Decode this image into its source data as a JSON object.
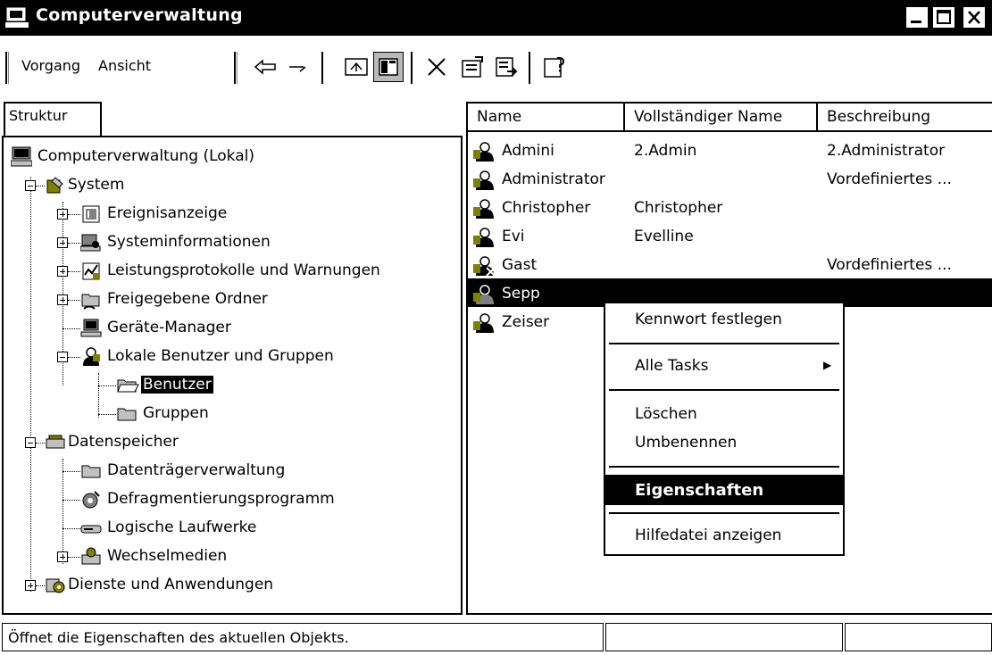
{
  "window": {
    "title": "Computerverwaltung",
    "controls": [
      "minimize",
      "maximize",
      "close"
    ]
  },
  "menu": {
    "items": [
      {
        "label": "Vorgang"
      },
      {
        "label": "Ansicht"
      }
    ]
  },
  "toolbar": {
    "icons": [
      "back-arrow-icon",
      "forward-arrow-icon",
      "up-folder-icon",
      "show-hide-tree-icon",
      "delete-icon",
      "properties-icon",
      "export-list-icon",
      "help-icon"
    ]
  },
  "tree": {
    "tab_label": "Struktur",
    "nodes": [
      {
        "label": "Computerverwaltung (Lokal)",
        "icon": "computer-icon",
        "level": 0
      },
      {
        "label": "System",
        "icon": "system-tools-icon",
        "level": 1,
        "expander": "minus"
      },
      {
        "label": "Ereignisanzeige",
        "icon": "event-viewer-icon",
        "level": 2,
        "expander": "plus"
      },
      {
        "label": "Systeminformationen",
        "icon": "system-info-icon",
        "level": 2,
        "expander": "plus"
      },
      {
        "label": "Leistungsprotokolle und Warnungen",
        "icon": "performance-logs-icon",
        "level": 2,
        "expander": "plus"
      },
      {
        "label": "Freigegebene Ordner",
        "icon": "shared-folders-icon",
        "level": 2,
        "expander": "plus"
      },
      {
        "label": "Geräte-Manager",
        "icon": "device-manager-icon",
        "level": 2
      },
      {
        "label": "Lokale Benutzer und Gruppen",
        "icon": "local-users-icon",
        "level": 2,
        "expander": "minus"
      },
      {
        "label": "Benutzer",
        "icon": "folder-open-icon",
        "level": 3,
        "selected": true
      },
      {
        "label": "Gruppen",
        "icon": "folder-icon",
        "level": 3
      },
      {
        "label": "Datenspeicher",
        "icon": "storage-icon",
        "level": 1,
        "expander": "minus"
      },
      {
        "label": "Datenträgerverwaltung",
        "icon": "folder-icon",
        "level": 2
      },
      {
        "label": "Defragmentierungsprogramm",
        "icon": "defrag-icon",
        "level": 2
      },
      {
        "label": "Logische Laufwerke",
        "icon": "drive-icon",
        "level": 2
      },
      {
        "label": "Wechselmedien",
        "icon": "removable-media-icon",
        "level": 2,
        "expander": "plus"
      },
      {
        "label": "Dienste und Anwendungen",
        "icon": "services-icon",
        "level": 1,
        "expander": "plus"
      }
    ]
  },
  "list": {
    "columns": [
      "Name",
      "Vollständiger Name",
      "Beschreibung"
    ],
    "rows": [
      {
        "name": "Admini",
        "full_name": "2.Admin",
        "description": "2.Administrator",
        "disabled": false
      },
      {
        "name": "Administrator",
        "full_name": "",
        "description": "Vordefiniertes ...",
        "disabled": false
      },
      {
        "name": "Christopher",
        "full_name": "Christopher",
        "description": "",
        "disabled": false
      },
      {
        "name": "Evi",
        "full_name": "Evelline",
        "description": "",
        "disabled": false
      },
      {
        "name": "Gast",
        "full_name": "",
        "description": "Vordefiniertes ...",
        "disabled": true
      },
      {
        "name": "Sepp",
        "full_name": "",
        "description": "",
        "disabled": false,
        "selected": true
      },
      {
        "name": "Zeiser",
        "full_name": "",
        "description": "",
        "disabled": false
      }
    ]
  },
  "context_menu": {
    "items": [
      {
        "label": "Kennwort festlegen"
      },
      {
        "label": "Alle Tasks",
        "submenu": true
      },
      {
        "label": "Löschen"
      },
      {
        "label": "Umbenennen"
      },
      {
        "label": "Eigenschaften",
        "default": true,
        "highlighted": true
      },
      {
        "label": "Hilfedatei anzeigen"
      }
    ],
    "submenu_arrow": "▶"
  },
  "status": {
    "text": "Öffnet die Eigenschaften des aktuellen Objekts.",
    "cells": [
      "",
      ""
    ]
  },
  "colors": {
    "highlight": "#000000",
    "background": "#ffffff",
    "icon_accent": "#808000"
  }
}
